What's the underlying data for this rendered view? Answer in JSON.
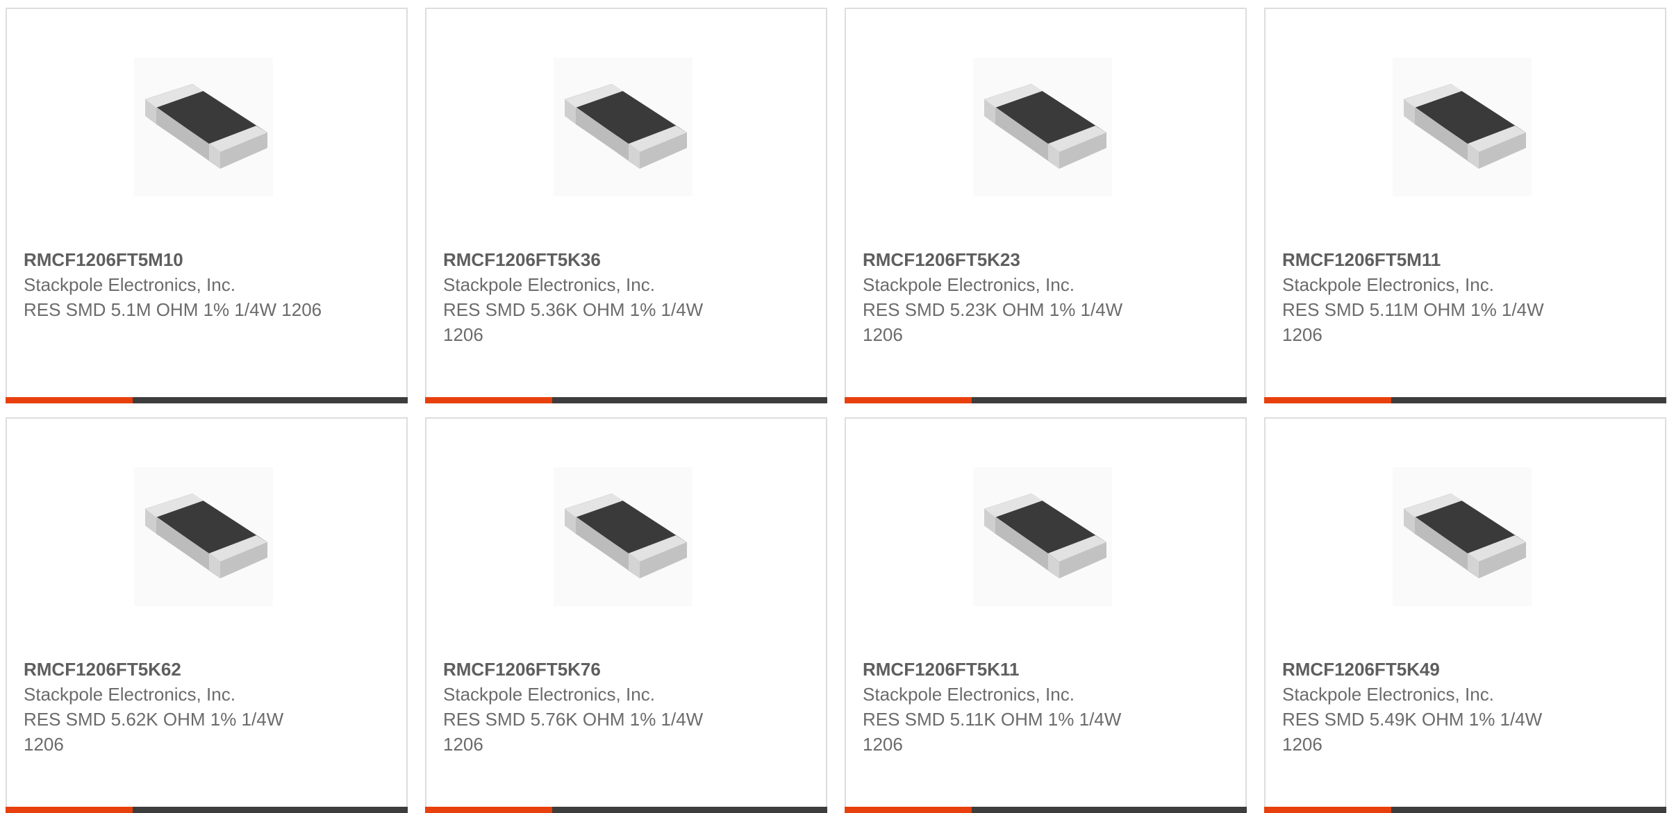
{
  "colors": {
    "accent": "#e8400c",
    "bar_base": "#3d3d3d",
    "text": "#6b6b6b",
    "card_border": "#dddddd"
  },
  "products": [
    {
      "part_number": "RMCF1206FT5M10",
      "manufacturer": "Stackpole Electronics, Inc.",
      "description": "RES SMD 5.1M OHM 1% 1/4W 1206",
      "image_icon": "smd-resistor-image"
    },
    {
      "part_number": "RMCF1206FT5K36",
      "manufacturer": "Stackpole Electronics, Inc.",
      "description": "RES SMD 5.36K OHM 1% 1/4W 1206",
      "image_icon": "smd-resistor-image"
    },
    {
      "part_number": "RMCF1206FT5K23",
      "manufacturer": "Stackpole Electronics, Inc.",
      "description": "RES SMD 5.23K OHM 1% 1/4W 1206",
      "image_icon": "smd-resistor-image"
    },
    {
      "part_number": "RMCF1206FT5M11",
      "manufacturer": "Stackpole Electronics, Inc.",
      "description": "RES SMD 5.11M OHM 1% 1/4W 1206",
      "image_icon": "smd-resistor-image"
    },
    {
      "part_number": "RMCF1206FT5K62",
      "manufacturer": "Stackpole Electronics, Inc.",
      "description": "RES SMD 5.62K OHM 1% 1/4W 1206",
      "image_icon": "smd-resistor-image"
    },
    {
      "part_number": "RMCF1206FT5K76",
      "manufacturer": "Stackpole Electronics, Inc.",
      "description": "RES SMD 5.76K OHM 1% 1/4W 1206",
      "image_icon": "smd-resistor-image"
    },
    {
      "part_number": "RMCF1206FT5K11",
      "manufacturer": "Stackpole Electronics, Inc.",
      "description": "RES SMD 5.11K OHM 1% 1/4W 1206",
      "image_icon": "smd-resistor-image"
    },
    {
      "part_number": "RMCF1206FT5K49",
      "manufacturer": "Stackpole Electronics, Inc.",
      "description": "RES SMD 5.49K OHM 1% 1/4W 1206",
      "image_icon": "smd-resistor-image"
    }
  ]
}
